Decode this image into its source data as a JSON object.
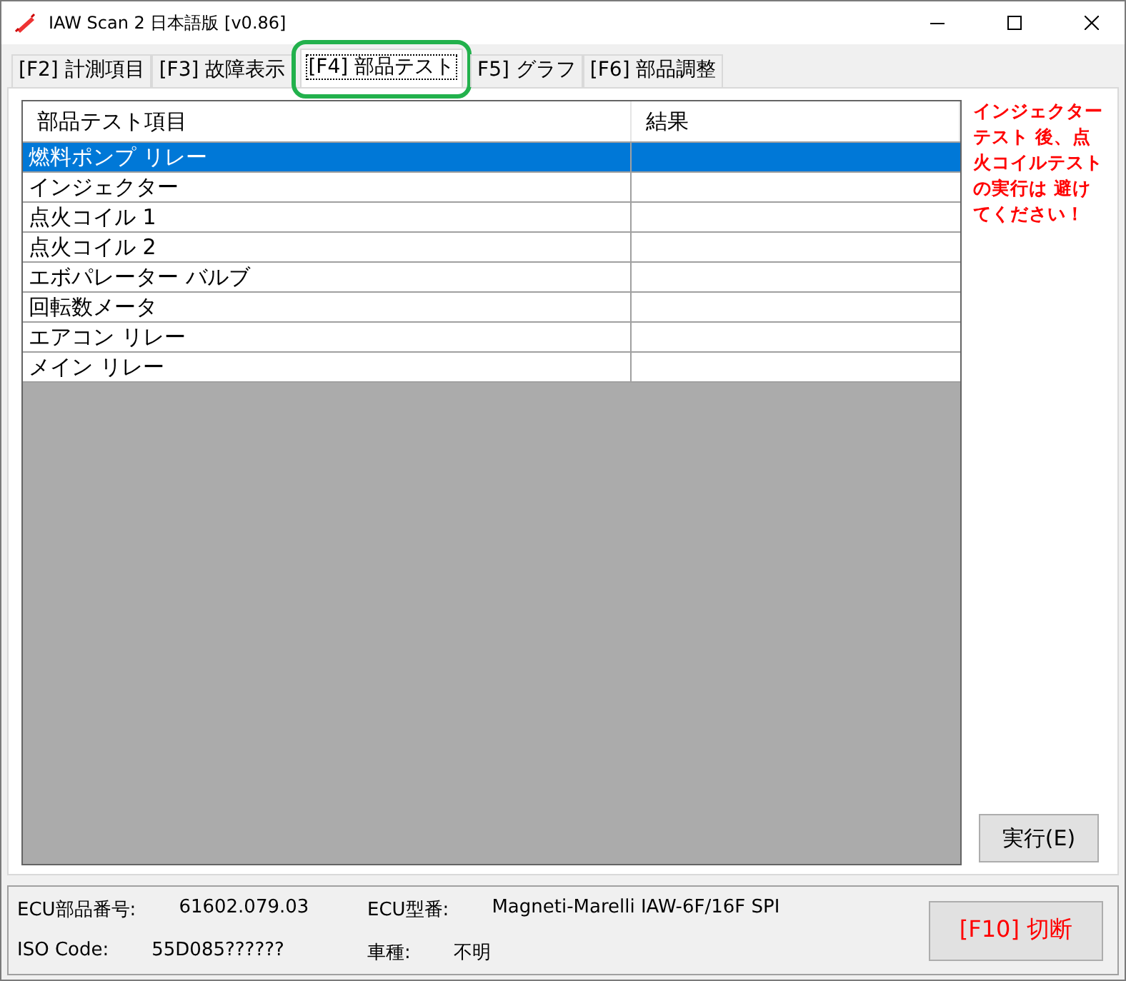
{
  "window": {
    "title": "IAW Scan 2 日本語版 [v0.86]"
  },
  "tabs": [
    {
      "label": "[F2] 計測項目",
      "selected": false
    },
    {
      "label": "[F3] 故障表示",
      "selected": false
    },
    {
      "label": "[F4] 部品テスト",
      "selected": true,
      "highlighted": true
    },
    {
      "label": "F5] グラフ",
      "selected": false
    },
    {
      "label": "[F6] 部品調整",
      "selected": false
    }
  ],
  "table": {
    "columns": [
      "部品テスト項目",
      "結果"
    ],
    "rows": [
      {
        "item": "燃料ポンプ リレー",
        "selected": true
      },
      {
        "item": "インジェクター",
        "selected": false
      },
      {
        "item": "点火コイル 1",
        "selected": false
      },
      {
        "item": "点火コイル 2",
        "selected": false
      },
      {
        "item": "エボパレーター バルブ",
        "selected": false
      },
      {
        "item": "回転数メータ",
        "selected": false
      },
      {
        "item": "エアコン リレー",
        "selected": false
      },
      {
        "item": "メイン リレー",
        "selected": false
      }
    ]
  },
  "warning_lines": [
    "インジェクター",
    "テスト 後、点",
    "火コイルテスト",
    "の実行は 避け",
    "てください！"
  ],
  "run_button": "実行(E)",
  "info": [
    {
      "label": "ECU部品番号:",
      "value": "61602.079.03"
    },
    {
      "label": "ECU型番:",
      "value": "Magneti-Marelli IAW-6F/16F SPI"
    },
    {
      "label": "ISO Code:",
      "value": "55D085??????"
    },
    {
      "label": "車種:",
      "value": "不明"
    }
  ],
  "disconnect_button": "[F10] 切断"
}
